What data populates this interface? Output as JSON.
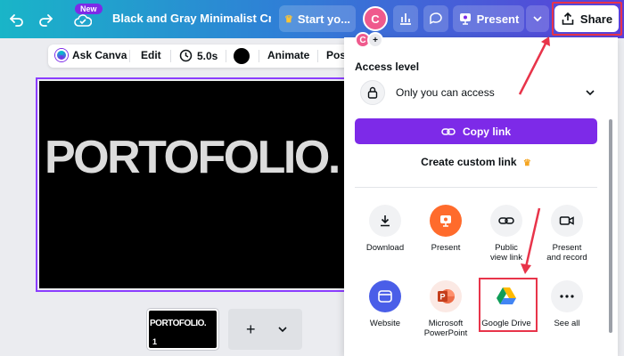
{
  "topbar": {
    "new_badge": "New",
    "title": "Black and Gray Minimalist Creat...",
    "start_label": "Start yo...",
    "avatar_initial": "C",
    "present_label": "Present",
    "share_label": "Share"
  },
  "editor_toolbar": {
    "ask_canva": "Ask Canva",
    "edit": "Edit",
    "duration": "5.0s",
    "animate": "Animate",
    "position": "Posi"
  },
  "canvas": {
    "text": "PORTOFOLIO."
  },
  "pages": {
    "thumbnail_text": "PORTOFOLIO.",
    "thumbnail_number": "1",
    "add_label": "+"
  },
  "share_panel": {
    "avatar_initial": "C",
    "add_people": "+",
    "access_level_label": "Access level",
    "access_value": "Only you can access",
    "copy_link_label": "Copy link",
    "custom_link_label": "Create custom link",
    "options": [
      {
        "label": "Download",
        "icon": "download-icon"
      },
      {
        "label": "Present",
        "icon": "present-icon"
      },
      {
        "label": "Public\nview link",
        "icon": "link-icon"
      },
      {
        "label": "Present\nand record",
        "icon": "camera-icon"
      },
      {
        "label": "Website",
        "icon": "website-icon"
      },
      {
        "label": "Microsoft\nPowerPoint",
        "icon": "powerpoint-icon"
      },
      {
        "label": "Google Drive",
        "icon": "google-drive-icon"
      },
      {
        "label": "See all",
        "icon": "more-icon"
      }
    ]
  },
  "colors": {
    "accent_purple": "#7d2ae8",
    "annotation_red": "#e8344a",
    "canvas_bg": "#000000"
  }
}
